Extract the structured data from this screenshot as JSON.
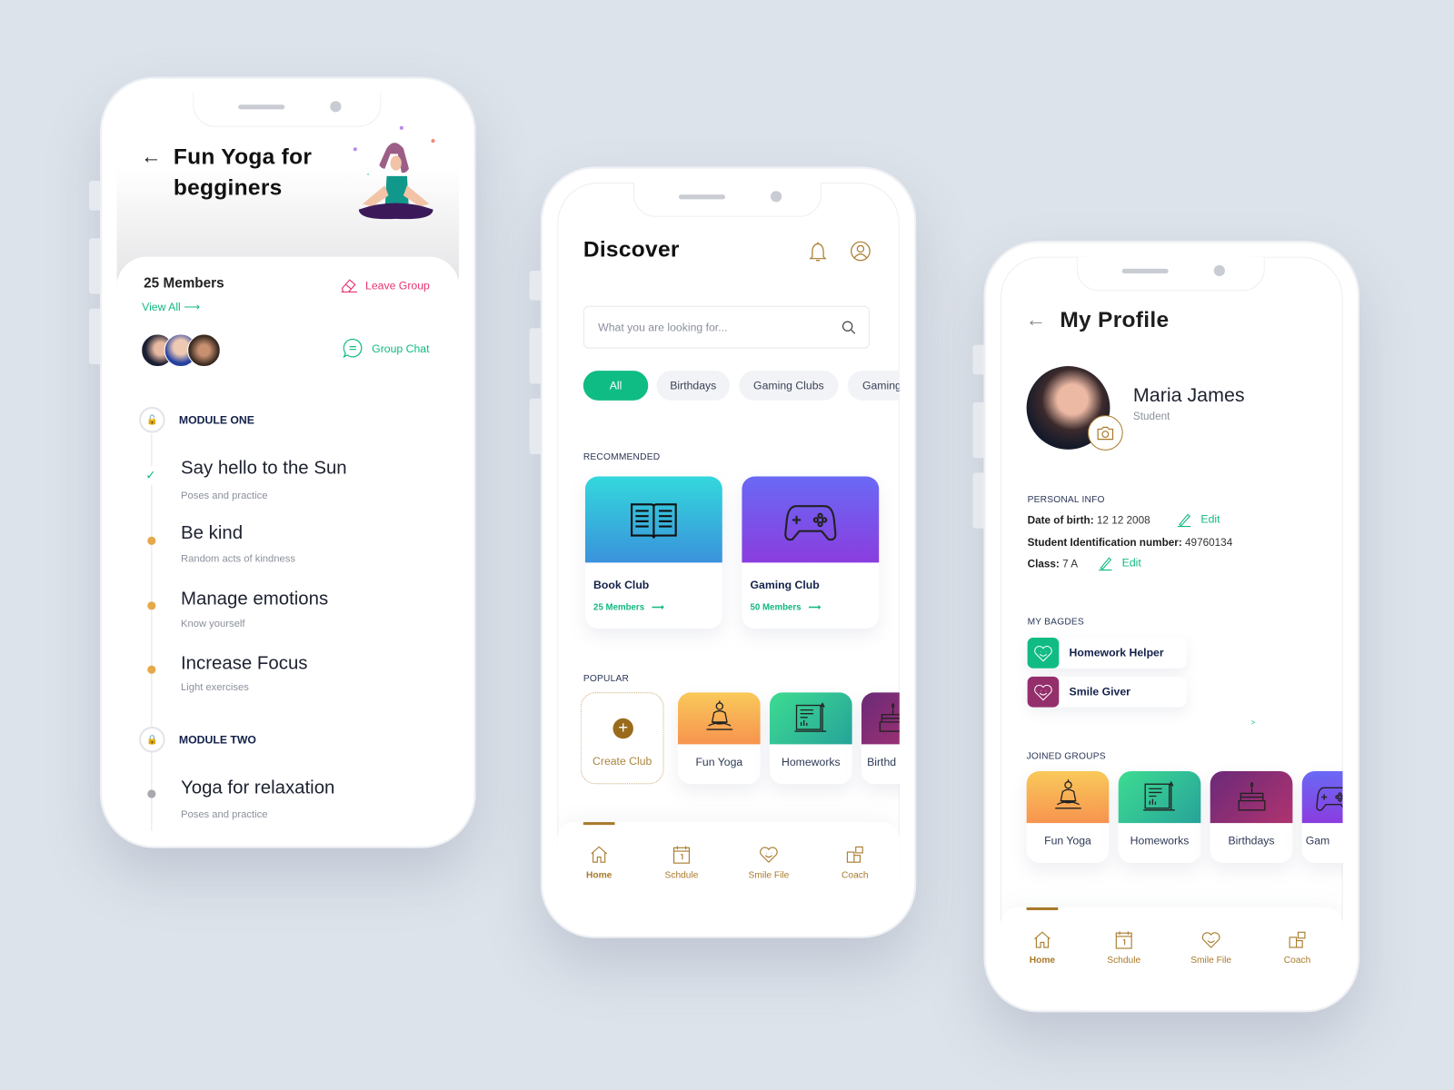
{
  "colors": {
    "accent_green": "#10b981",
    "gold": "#a87a2a",
    "pink": "#e8336f",
    "navy": "#13214a",
    "background": "#dde3ea"
  },
  "yoga_screen": {
    "title_line1": "Fun Yoga for",
    "title_line2": "begginers",
    "members": "25 Members",
    "view_all": "View All",
    "leave_group": "Leave Group",
    "group_chat": "Group Chat",
    "modules": [
      {
        "title": "MODULE ONE",
        "steps": [
          {
            "title": "Say hello to the Sun",
            "subtitle": "Poses and practice",
            "status": "done"
          },
          {
            "title": "Be kind",
            "subtitle": "Random acts of kindness",
            "status": "pending"
          },
          {
            "title": "Manage emotions",
            "subtitle": "Know yourself",
            "status": "pending"
          },
          {
            "title": "Increase Focus",
            "subtitle": "Light exercises",
            "status": "pending"
          }
        ]
      },
      {
        "title": "MODULE TWO",
        "steps": [
          {
            "title": "Yoga for relaxation",
            "subtitle": "Poses and practice",
            "status": "locked"
          }
        ]
      }
    ]
  },
  "discover_screen": {
    "title": "Discover",
    "search_placeholder": "What you are looking for...",
    "chips": [
      "All",
      "Birthdays",
      "Gaming Clubs",
      "Gaming"
    ],
    "recommended_label": "RECOMMENDED",
    "recommended": [
      {
        "name": "Book Club",
        "members": "25 Members",
        "icon": "book-icon"
      },
      {
        "name": "Gaming Club",
        "members": "50 Members",
        "icon": "gamepad-icon"
      }
    ],
    "popular_label": "POPULAR",
    "create_club": "Create Club",
    "popular": [
      "Fun Yoga",
      "Homeworks",
      "Birthd"
    ]
  },
  "profile_screen": {
    "title": "My Profile",
    "name": "Maria James",
    "role": "Student",
    "personal_info_label": "PERSONAL INFO",
    "dob_label": "Date of birth:",
    "dob": "12 12 2008",
    "sid_label": "Student Identification number:",
    "sid": "49760134",
    "class_label": "Class:",
    "class": "7 A",
    "edit": "Edit",
    "badges_label": "MY BAGDES",
    "badges": [
      "Homework Helper",
      "Smile Giver"
    ],
    "more": ">",
    "groups_label": "JOINED GROUPS",
    "groups": [
      "Fun Yoga",
      "Homeworks",
      "Birthdays",
      "Gam"
    ]
  },
  "nav": [
    "Home",
    "Schdule",
    "Smile File",
    "Coach"
  ]
}
